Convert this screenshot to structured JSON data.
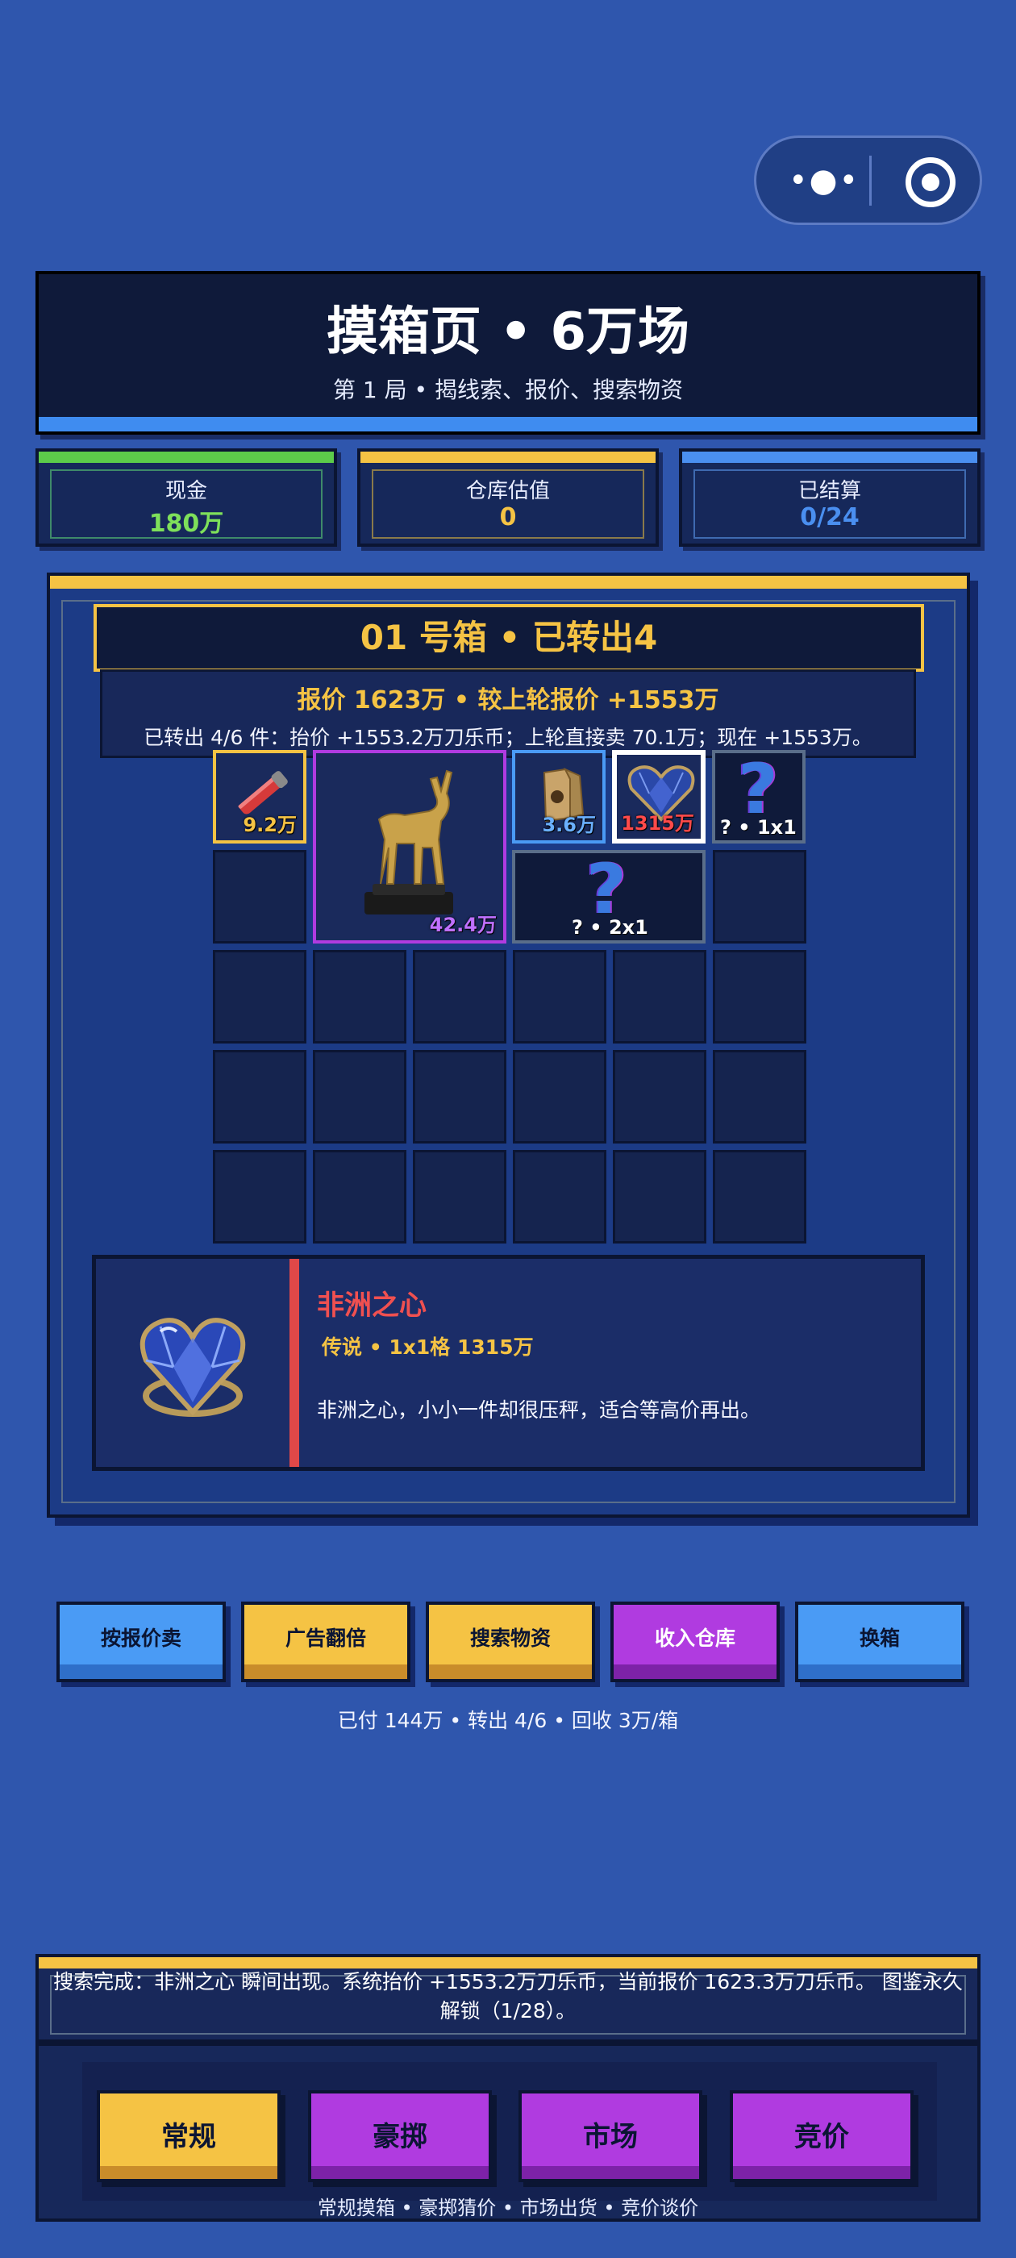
{
  "header": {
    "title": "摸箱页 • 6万场",
    "subtitle": "第 1 局 • 揭线索、报价、搜索物资"
  },
  "stats": [
    {
      "label": "现金",
      "value": "180万",
      "color": "#7ee05a"
    },
    {
      "label": "仓库估值",
      "value": "0",
      "color": "#f5c344"
    },
    {
      "label": "已结算",
      "value": "0/24",
      "color": "#4a8ff0"
    }
  ],
  "box": {
    "title": "01 号箱 • 已转出4",
    "quote_line": "报价 1623万 • 较上轮报价 +1553万",
    "detail_line": "已转出 4/6 件：抬价 +1553.2万刀乐币；上轮直接卖 70.1万；现在 +1553万。"
  },
  "grid_items": [
    {
      "name": "red-stick-item",
      "price": "9.2万",
      "border": "#f5c344",
      "price_color": "#f5c344"
    },
    {
      "name": "golden-deer-item",
      "price": "42.4万",
      "border": "#b03be0",
      "price_color": "#c070ff"
    },
    {
      "name": "coffee-bag-item",
      "price": "3.6万",
      "border": "#4a9bf5",
      "price_color": "#6ab0ff"
    },
    {
      "name": "heart-gem-item",
      "price": "1315万",
      "border": "#ffffff",
      "price_color": "#ff4a4a"
    },
    {
      "name": "unknown-item-1x1",
      "label": "? • 1x1",
      "border": "#5a6e8a"
    },
    {
      "name": "unknown-item-2x1",
      "label": "? • 2x1",
      "border": "#5a6e8a"
    }
  ],
  "detail": {
    "name": "非洲之心",
    "meta": "传说 • 1x1格 1315万",
    "desc": "非洲之心，小小一件却很压秤，适合等高价再出。"
  },
  "actions": [
    {
      "label": "按报价卖",
      "bg": "#4a9bf5",
      "strip": "#2f6fc9",
      "fg": "#0b1533"
    },
    {
      "label": "广告翻倍",
      "bg": "#f5c344",
      "strip": "#c98c2a",
      "fg": "#0b1533"
    },
    {
      "label": "搜索物资",
      "bg": "#f5c344",
      "strip": "#c98c2a",
      "fg": "#0b1533"
    },
    {
      "label": "收入仓库",
      "bg": "#b03be0",
      "strip": "#7d22a8",
      "fg": "#ffffff"
    },
    {
      "label": "换箱",
      "bg": "#4a9bf5",
      "strip": "#2f6fc9",
      "fg": "#0b1533"
    }
  ],
  "status_line": "已付 144万 • 转出 4/6 • 回收 3万/箱",
  "log_text": "搜索完成：非洲之心 瞬间出现。系统抬价 +1553.2万刀乐币，当前报价 1623.3万刀乐币。 图鉴永久解锁（1/28）。",
  "nav": [
    {
      "label": "常规",
      "bg": "#f5c344",
      "strip": "#c98c2a",
      "fg": "#0b1533"
    },
    {
      "label": "豪掷",
      "bg": "#b03be0",
      "strip": "#7d22a8",
      "fg": "#0b1533"
    },
    {
      "label": "市场",
      "bg": "#b03be0",
      "strip": "#7d22a8",
      "fg": "#0b1533"
    },
    {
      "label": "竞价",
      "bg": "#b03be0",
      "strip": "#7d22a8",
      "fg": "#0b1533"
    }
  ],
  "nav_caption": "常规摸箱 • 豪掷猜价 • 市场出货 • 竞价谈价"
}
